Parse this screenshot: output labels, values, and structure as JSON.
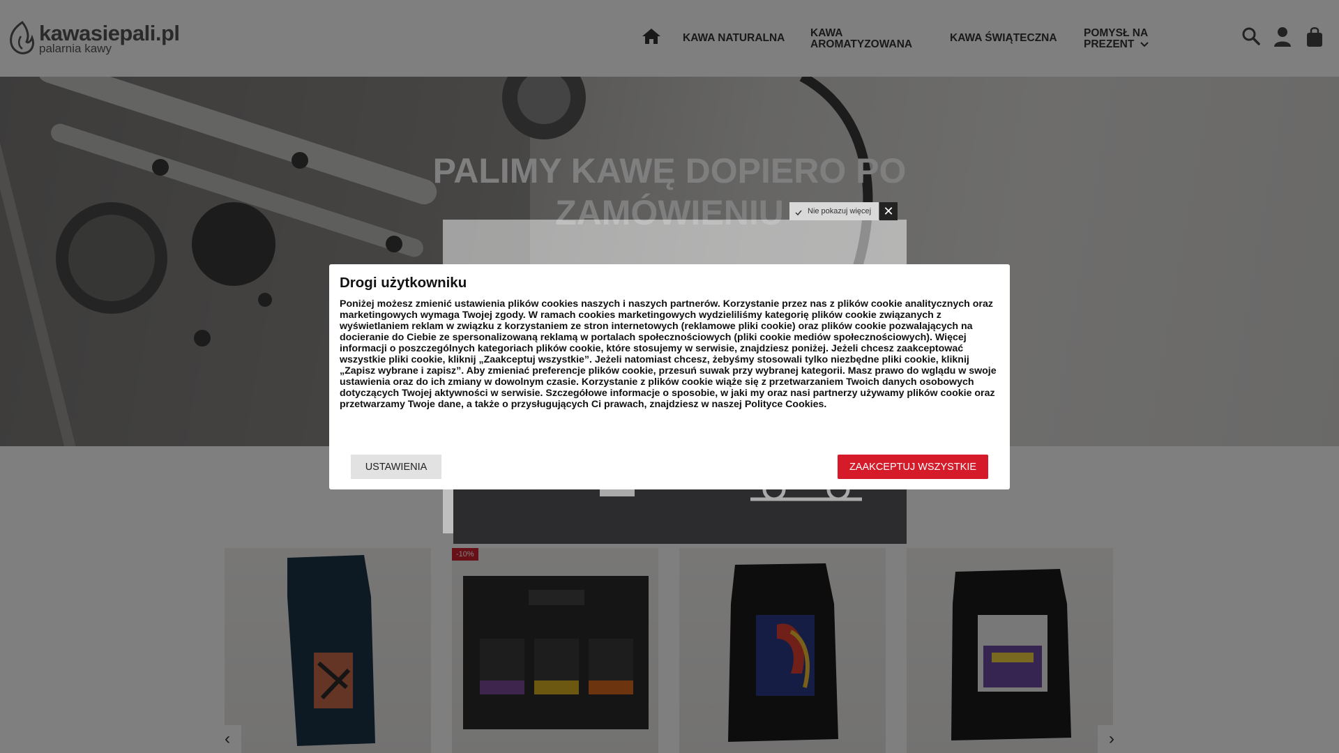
{
  "header": {
    "logo_name": "kawasiepali.pl",
    "logo_sub": "palarnia kawy",
    "nav": [
      {
        "label": "KAWA NATURALNA"
      },
      {
        "label": "KAWA AROMATYZOWANA"
      },
      {
        "label": "KAWA ŚWIĄTECZNA"
      },
      {
        "label": "POMYSŁ NA PREZENT"
      }
    ],
    "icons": [
      "home-icon",
      "search-icon",
      "user-icon",
      "bag-icon"
    ]
  },
  "hero": {
    "title": "PALIMY KAWĘ DOPIERO PO ZAMÓWIENIU"
  },
  "popup": {
    "dont_show_label": "Nie pokazuj więcej",
    "close_label": "✕"
  },
  "products": [
    {
      "badge": ""
    },
    {
      "badge": "-10%"
    },
    {
      "badge": ""
    },
    {
      "badge": ""
    }
  ],
  "cookie": {
    "title": "Drogi użytkowniku",
    "body": "Poniżej możesz zmienić ustawienia plików cookies naszych i naszych partnerów. Korzystanie przez nas z plików cookie analitycznych oraz marketingowych wymaga Twojej zgody. W ramach cookies marketingowych wydzieliliśmy kategorię plików cookie związanych z wyświetlaniem reklam w związku z korzystaniem ze stron internetowych (reklamowe pliki cookie) oraz plików cookie pozwalających na docieranie do Ciebie ze spersonalizowaną reklamą w portalach społecznościowych (pliki cookie mediów społecznościowych). Więcej informacji o poszczególnych kategoriach plików cookie, które stosujemy w serwisie, znajdziesz poniżej. Jeżeli chcesz zaakceptować wszystkie pliki cookie, kliknij „Zaakceptuj wszystkie”. Jeżeli natomiast chcesz, żebyśmy stosowali tylko niezbędne pliki cookie, kliknij „Zapisz wybrane i zapisz”. Aby zmieniać preferencje plików cookie, przesuń suwak przy wybranej kategorii. Masz prawo do wglądu w swoje ustawienia oraz do ich zmiany w dowolnym czasie. Korzystanie z plików cookie wiąże się z przetwarzaniem Twoich danych osobowych dotyczących Twojej aktywności w serwisie. Szczegółowe informacje o sposobie, w jaki my oraz nasi partnerzy używamy plików cookie oraz przetwarzamy Twoje dane, a także o przysługujących Ci prawach, znajdziesz w naszej Polityce Cookies.",
    "settings_label": "USTAWIENIA",
    "accept_label": "ZAAKCEPTUJ WSZYSTKIE"
  },
  "colors": {
    "accent": "#d51b2a",
    "overlay": "rgba(0,0,0,0.5)"
  }
}
